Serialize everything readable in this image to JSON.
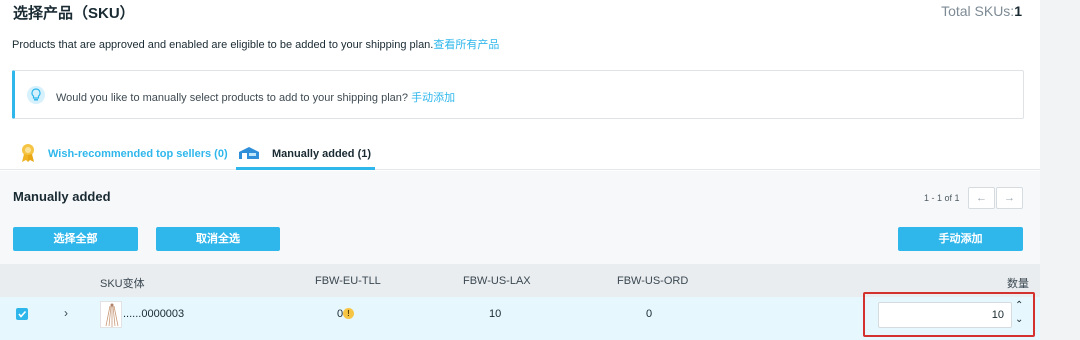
{
  "header": {
    "title": "选择产品（SKU）",
    "total_label": "Total SKUs:",
    "total_value": "1"
  },
  "description": {
    "text": "Products that are approved and enabled are eligible to be added to your shipping plan.",
    "link": "查看所有产品"
  },
  "notice": {
    "text": "Would you like to manually select products to add to your shipping plan?",
    "link": "手动添加",
    "icon": "lightbulb-icon"
  },
  "tabs": [
    {
      "label": "Wish-recommended top sellers (0)",
      "icon": "award-ribbon-icon",
      "active": false
    },
    {
      "label": "Manually added (1)",
      "icon": "warehouse-icon",
      "active": true
    }
  ],
  "section": {
    "title": "Manually added",
    "pager": "1 - 1 of 1",
    "buttons": {
      "select_all": "选择全部",
      "deselect_all": "取消全选",
      "manual_add": "手动添加"
    }
  },
  "table": {
    "columns": [
      "SKU变体",
      "FBW-EU-TLL",
      "FBW-US-LAX",
      "FBW-US-ORD",
      "数量"
    ],
    "rows": [
      {
        "checked": true,
        "sku": "......0000003",
        "eu_tll": "0",
        "us_lax": "10",
        "us_ord": "0",
        "quantity": "10"
      }
    ]
  },
  "colors": {
    "accent": "#2fb7ec",
    "highlight_border": "#d3322e",
    "warning": "#f7c544"
  }
}
